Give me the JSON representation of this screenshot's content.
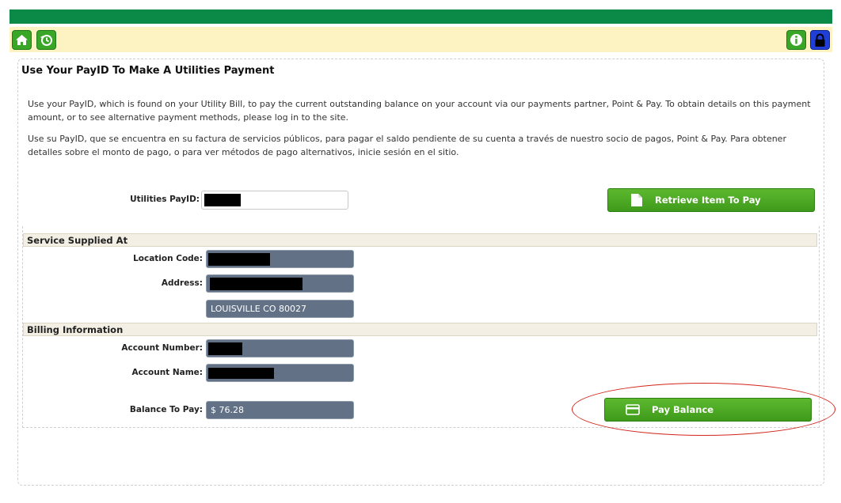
{
  "toolbar": {
    "home_icon": "home-icon",
    "history_icon": "history-icon",
    "info_icon": "info-icon",
    "lock_icon": "lock-icon"
  },
  "page": {
    "title": "Use Your PayID To Make A Utilities Payment",
    "intro_en": "Use your PayID, which is found on your Utility Bill, to pay the current outstanding balance on your account via our payments partner, Point & Pay. To obtain details on this payment amount, or to see alternative payment methods, please log in to the site.",
    "intro_es": "Use su PayID, que se encuentra en su factura de servicios públicos, para pagar el saldo pendiente de su cuenta a través de nuestro socio de pagos, Point & Pay. Para obtener detalles sobre el monto de pago, o para ver métodos de pago alternativos, inicie sesión en el sitio."
  },
  "payid": {
    "label": "Utilities PayID:",
    "value": "",
    "retrieve_button": "Retrieve Item To Pay"
  },
  "service": {
    "header": "Service Supplied At",
    "location_code_label": "Location Code:",
    "address_label": "Address:",
    "city_line": "LOUISVILLE CO 80027"
  },
  "billing": {
    "header": "Billing Information",
    "account_number_label": "Account Number:",
    "account_name_label": "Account Name:",
    "balance_label": "Balance To Pay:",
    "balance_value": "$ 76.28",
    "pay_button": "Pay Balance"
  },
  "colors": {
    "brand_green": "#0a8a46",
    "button_green": "#4caf24",
    "toolbar_bg": "#fdf2c2",
    "field_bg": "#627185",
    "annotation_red": "#d1261c"
  }
}
